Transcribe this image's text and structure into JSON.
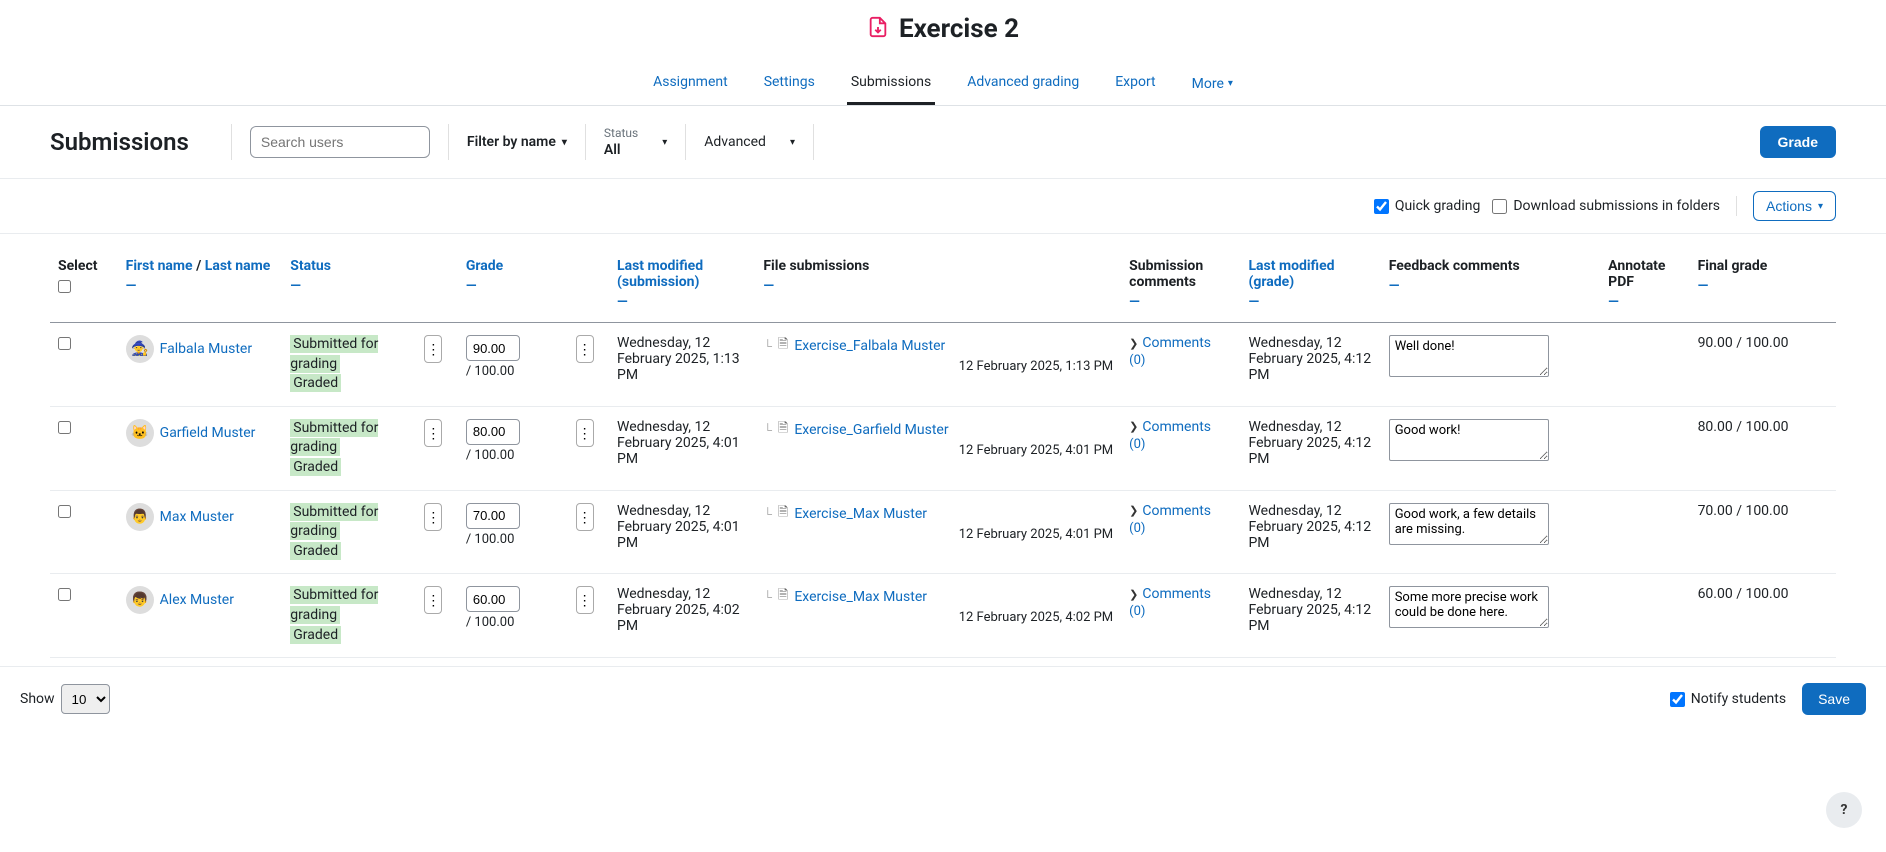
{
  "page_title": "Exercise 2",
  "tabs": [
    {
      "id": "assignment",
      "label": "Assignment",
      "active": false
    },
    {
      "id": "settings",
      "label": "Settings",
      "active": false
    },
    {
      "id": "submissions",
      "label": "Submissions",
      "active": true
    },
    {
      "id": "advgrading",
      "label": "Advanced grading",
      "active": false
    },
    {
      "id": "export",
      "label": "Export",
      "active": false
    },
    {
      "id": "more",
      "label": "More",
      "active": false,
      "dropdown": true
    }
  ],
  "filters": {
    "section_title": "Submissions",
    "search_placeholder": "Search users",
    "filter_by_name": "Filter by name",
    "status_label": "Status",
    "status_value": "All",
    "advanced": "Advanced",
    "grade_button": "Grade"
  },
  "options": {
    "quick_grading_label": "Quick grading",
    "quick_grading_checked": true,
    "download_folders_label": "Download submissions in folders",
    "download_folders_checked": false,
    "actions_label": "Actions"
  },
  "columns": {
    "select": "Select",
    "first_name": "First name",
    "last_name": "Last name",
    "name_sep": " / ",
    "status": "Status",
    "grade": "Grade",
    "last_modified_submission": "Last modified (submission)",
    "file_submissions": "File submissions",
    "submission_comments": "Submission comments",
    "last_modified_grade": "Last modified (grade)",
    "feedback_comments": "Feedback comments",
    "annotate_pdf": "Annotate PDF",
    "final_grade": "Final grade",
    "collapse_indicator": "—"
  },
  "status_texts": {
    "submitted": "Submitted for grading",
    "graded": "Graded"
  },
  "comments_link": "Comments",
  "grade_max_suffix": " / 100.00",
  "rows": [
    {
      "avatar_emoji": "🧙",
      "name": "Falbala Muster",
      "grade_value": "90.00",
      "last_modified_submission": "Wednesday, 12 February 2025, 1:13 PM",
      "file_name": "Exercise_Falbala Muster",
      "file_date": "12 February 2025, 1:13 PM",
      "comments_count": "(0)",
      "last_modified_grade": "Wednesday, 12 February 2025, 4:12 PM",
      "feedback": "Well done!",
      "final_grade": "90.00 / 100.00"
    },
    {
      "avatar_emoji": "🐱",
      "name": "Garfield Muster",
      "grade_value": "80.00",
      "last_modified_submission": "Wednesday, 12 February 2025, 4:01 PM",
      "file_name": "Exercise_Garfield Muster",
      "file_date": "12 February 2025, 4:01 PM",
      "comments_count": "(0)",
      "last_modified_grade": "Wednesday, 12 February 2025, 4:12 PM",
      "feedback": "Good work!",
      "final_grade": "80.00 / 100.00"
    },
    {
      "avatar_emoji": "👨",
      "name": "Max Muster",
      "grade_value": "70.00",
      "last_modified_submission": "Wednesday, 12 February 2025, 4:01 PM",
      "file_name": "Exercise_Max Muster",
      "file_date": "12 February 2025, 4:01 PM",
      "comments_count": "(0)",
      "last_modified_grade": "Wednesday, 12 February 2025, 4:12 PM",
      "feedback": "Good work, a few details are missing.",
      "final_grade": "70.00 / 100.00"
    },
    {
      "avatar_emoji": "👦",
      "name": "Alex Muster",
      "grade_value": "60.00",
      "last_modified_submission": "Wednesday, 12 February 2025, 4:02 PM",
      "file_name": "Exercise_Max Muster",
      "file_date": "12 February 2025, 4:02 PM",
      "comments_count": "(0)",
      "last_modified_grade": "Wednesday, 12 February 2025, 4:12 PM",
      "feedback": "Some more precise work could be done here.",
      "final_grade": "60.00 / 100.00"
    }
  ],
  "footer": {
    "show_label": "Show",
    "show_value": "10",
    "notify_label": "Notify students",
    "notify_checked": true,
    "save_label": "Save"
  },
  "help_label": "?"
}
